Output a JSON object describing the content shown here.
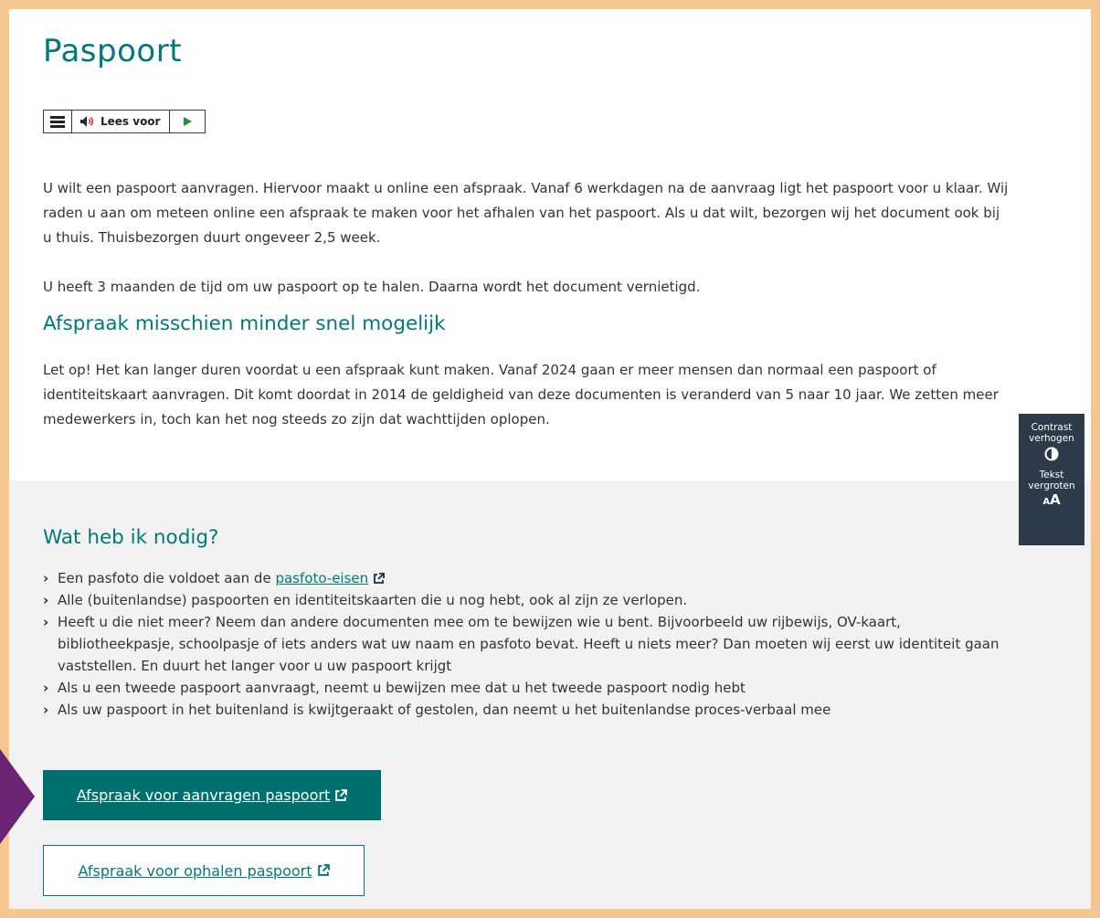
{
  "page": {
    "title": "Paspoort"
  },
  "readspeaker": {
    "menu_icon": "menu-icon",
    "read_label": "Lees voor",
    "play_icon": "play-icon"
  },
  "intro": {
    "p1": "U wilt een paspoort aanvragen. Hiervoor maakt u online een afspraak. Vanaf 6 werkdagen na de aanvraag ligt het paspoort voor u klaar. Wij raden u aan om meteen online een afspraak te maken voor het afhalen van het paspoort. Als u dat wilt, bezorgen wij het document ook bij u thuis. Thuisbezorgen duurt ongeveer 2,5 week.",
    "p2": "U heeft 3 maanden de tijd om uw paspoort op te halen. Daarna wordt het document vernietigd."
  },
  "notice": {
    "heading": "Afspraak misschien minder snel mogelijk",
    "text": "Let op! Het kan langer duren voordat u een afspraak kunt maken. Vanaf 2024 gaan er meer mensen dan normaal een paspoort of identiteitskaart aanvragen. Dit komt doordat in 2014 de geldigheid van deze documenten is veranderd van 5 naar 10 jaar. We zetten meer medewerkers in, toch kan het nog steeds zo zijn dat wachttijden oplopen."
  },
  "needs": {
    "heading": "Wat heb ik nodig?",
    "item1_prefix": "Een pasfoto die voldoet aan de ",
    "item1_link": "pasfoto-eisen",
    "item2": "Alle (buitenlandse) paspoorten en identiteitskaarten die u nog hebt, ook al zijn ze verlopen.",
    "item3": "Heeft u die niet meer? Neem dan andere documenten mee om te bewijzen wie u bent. Bijvoorbeeld uw rijbewijs, OV-kaart, bibliotheekpasje, schoolpasje of iets anders wat uw naam en pasfoto bevat. Heeft u niets meer? Dan moeten wij eerst uw identiteit gaan vaststellen. En duurt het langer voor u uw paspoort krijgt",
    "item4": "Als u een tweede paspoort aanvraagt, neemt u bewijzen mee dat u het tweede paspoort nodig hebt",
    "item5": "Als uw paspoort in het buitenland is kwijtgeraakt of gestolen, dan neemt u het buitenlandse proces-verbaal mee"
  },
  "buttons": {
    "apply": "Afspraak voor aanvragen paspoort",
    "pickup": "Afspraak voor ophalen paspoort"
  },
  "accessibility_tools": {
    "contrast_label": "Contrast verhogen",
    "contrast_icon": "contrast-icon",
    "text_label": "Tekst vergroten",
    "text_icon": "text-size-icon"
  },
  "colors": {
    "accent": "#007a78",
    "button_bg": "#00706e",
    "frame": "#f5c690",
    "tools_bg": "#2d3a4a"
  }
}
